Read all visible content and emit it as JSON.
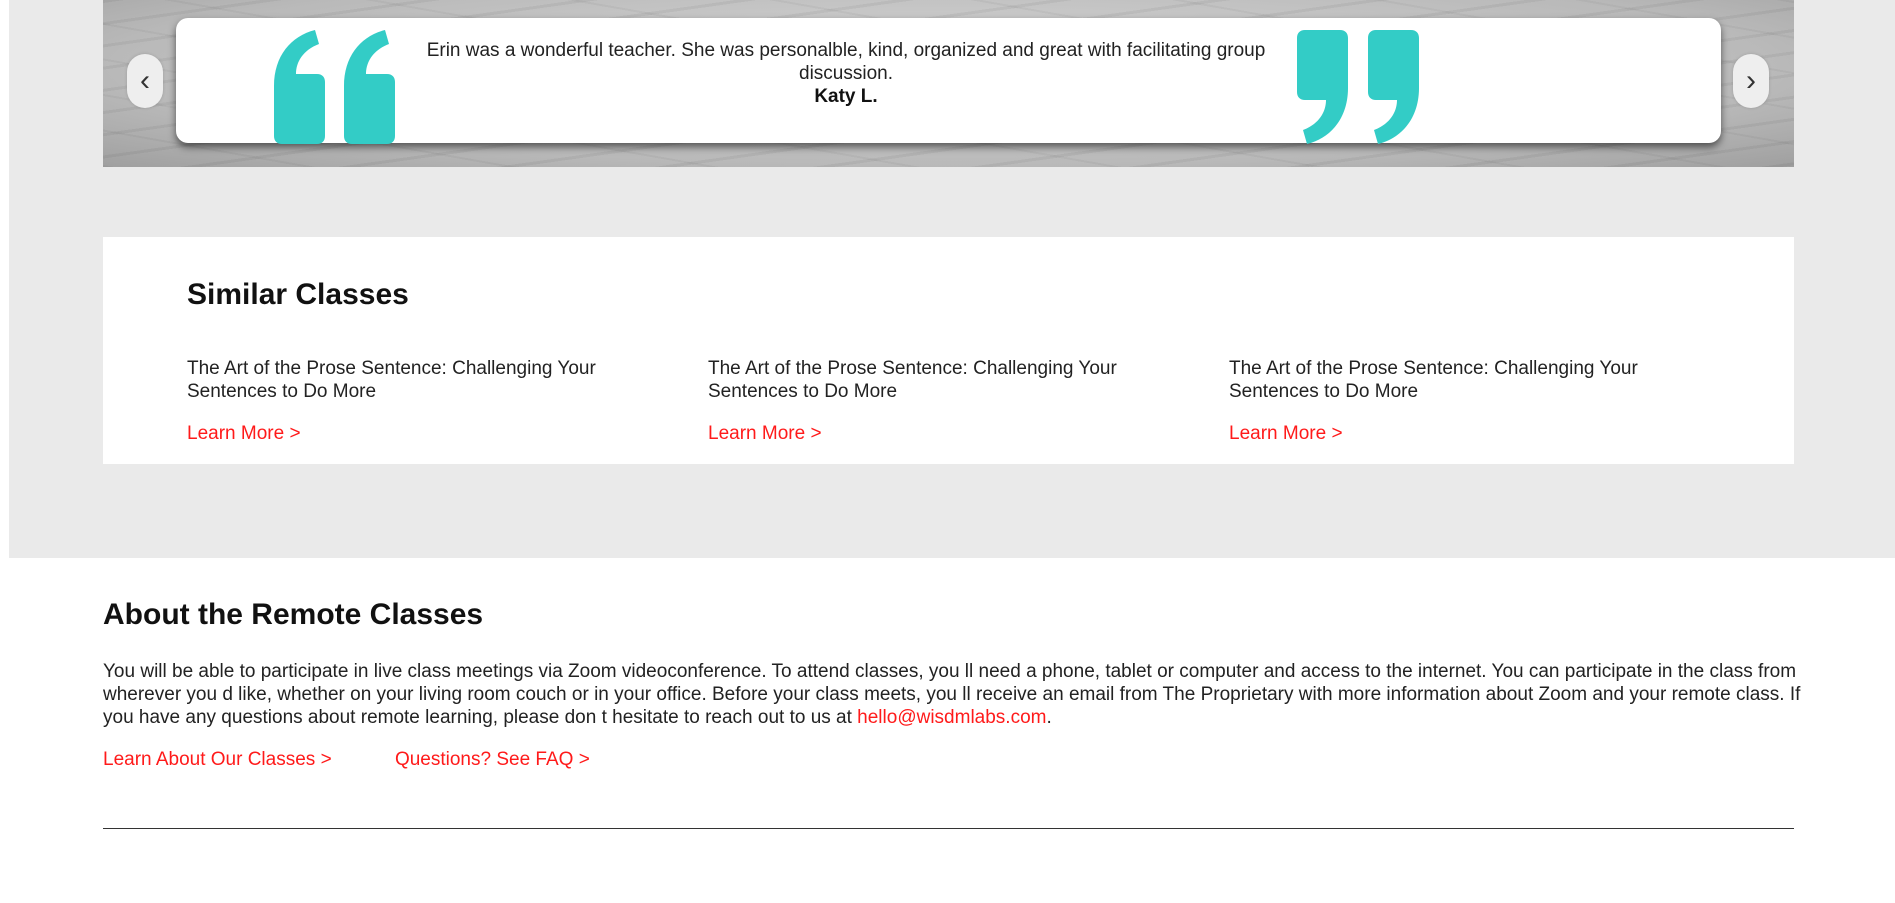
{
  "testimonial": {
    "quote": "Erin was a wonderful teacher. She was personalble, kind, organized and great with facilitating group discussion.",
    "author": "Katy L.",
    "prev_icon": "‹",
    "next_icon": "›",
    "quote_color": "#33ccc6"
  },
  "similar_classes": {
    "title": "Similar Classes",
    "items": [
      {
        "title": "The Art of the Prose Sentence: Challenging Your Sentences to Do More",
        "link": "Learn More >"
      },
      {
        "title": "The Art of the Prose Sentence: Challenging Your Sentences to Do More",
        "link": "Learn More >"
      },
      {
        "title": "The Art of the Prose Sentence: Challenging Your Sentences to Do More",
        "link": "Learn More >"
      }
    ]
  },
  "about": {
    "title": "About the Remote Classes",
    "body_before": "You will be able to participate in live class meetings via Zoom videoconference. To attend classes, you ll need a phone, tablet or computer and access to the internet. You can participate in the class from wherever you d like, whether on your living room couch or in your office. Before your class meets, you ll receive an email from The Proprietary with more information about Zoom and your remote class. If you have any questions about remote learning, please don t hesitate to reach out to us at ",
    "email": "hello@wisdmlabs.com",
    "body_after": ".",
    "link_classes": "Learn About Our Classes >",
    "link_faq": "Questions? See FAQ >"
  },
  "colors": {
    "accent_red": "#ff1a1a",
    "teal": "#33ccc6",
    "band_gray": "#eaeaea"
  }
}
